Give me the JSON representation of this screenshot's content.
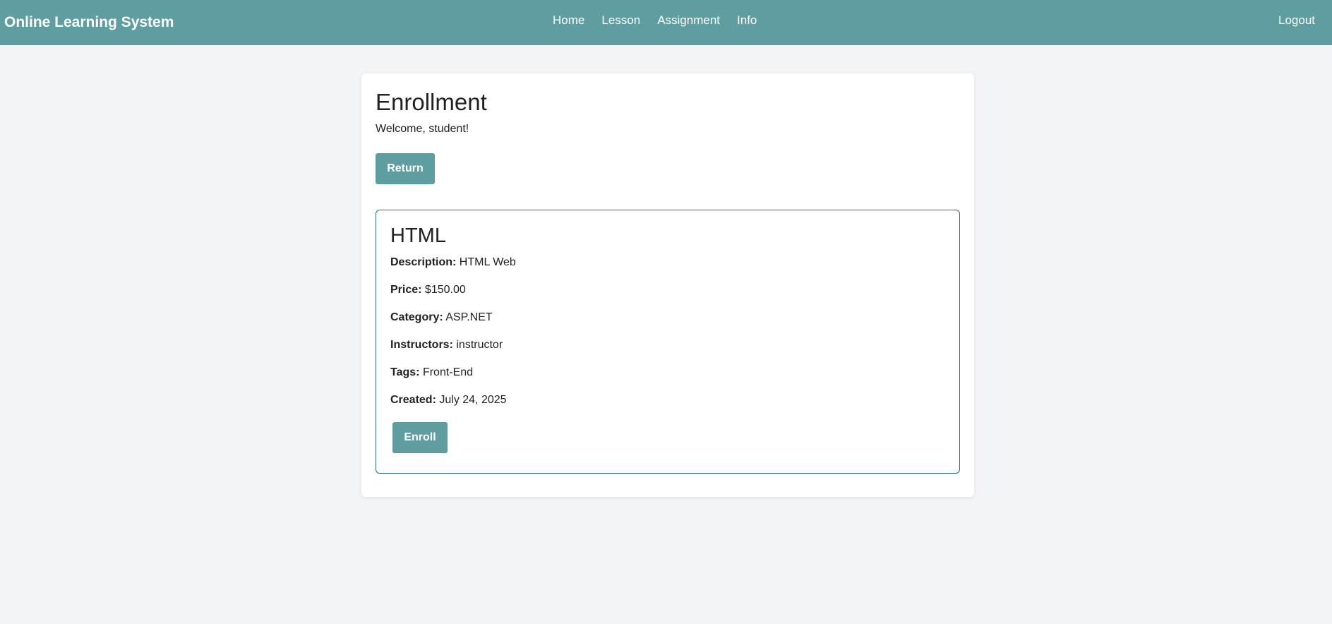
{
  "nav": {
    "brand": "Online Learning System",
    "links": [
      "Home",
      "Lesson",
      "Assignment",
      "Info"
    ],
    "logout": "Logout"
  },
  "page": {
    "title": "Enrollment",
    "welcome": "Welcome, student!",
    "return_label": "Return"
  },
  "course": {
    "name": "HTML",
    "fields": [
      {
        "label": "Description:",
        "value": "HTML Web"
      },
      {
        "label": "Price:",
        "value": "$150.00"
      },
      {
        "label": "Category:",
        "value": "ASP.NET"
      },
      {
        "label": "Instructors:",
        "value": "instructor"
      },
      {
        "label": "Tags:",
        "value": "Front-End"
      },
      {
        "label": "Created:",
        "value": "July 24, 2025"
      }
    ],
    "enroll_label": "Enroll"
  },
  "colors": {
    "accent": "#5f9ea0",
    "border": "#2f6b80",
    "background": "#f3f4f6"
  }
}
